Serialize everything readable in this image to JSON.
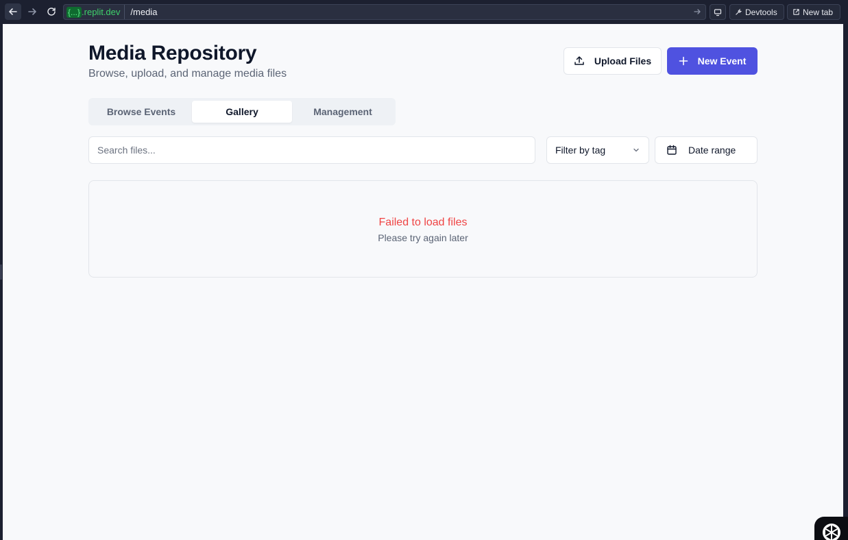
{
  "browser": {
    "url_domain_badge": "{...}",
    "url_domain": ".replit.dev",
    "url_path": "/media",
    "devtools_label": "Devtools",
    "new_tab_label": "New tab"
  },
  "page": {
    "title": "Media Repository",
    "subtitle": "Browse, upload, and manage media files"
  },
  "actions": {
    "upload_label": "Upload Files",
    "new_event_label": "New Event"
  },
  "tabs": [
    {
      "label": "Browse Events",
      "active": false
    },
    {
      "label": "Gallery",
      "active": true
    },
    {
      "label": "Management",
      "active": false
    }
  ],
  "filters": {
    "search_placeholder": "Search files...",
    "tag_filter_label": "Filter by tag",
    "date_range_label": "Date range"
  },
  "results": {
    "error_title": "Failed to load files",
    "error_message": "Please try again later"
  },
  "colors": {
    "primary": "#4f52e0",
    "error": "#ef4444",
    "background": "#f8f9fb"
  }
}
